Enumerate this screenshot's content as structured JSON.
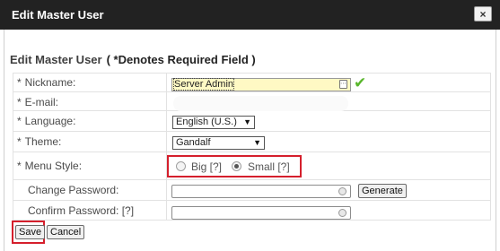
{
  "dialog": {
    "title": "Edit Master User",
    "close_glyph": "×"
  },
  "form": {
    "heading": "Edit Master User",
    "required_note": "( *Denotes Required Field )",
    "fields": {
      "nickname": {
        "star": "*",
        "label": "Nickname:",
        "value": "Server Admin"
      },
      "email": {
        "star": "*",
        "label": "E-mail:"
      },
      "language": {
        "star": "*",
        "label": "Language:",
        "value": "English (U.S.)"
      },
      "theme": {
        "star": "*",
        "label": "Theme:",
        "value": "Gandalf"
      },
      "menu_style": {
        "star": "*",
        "label": "Menu Style:",
        "options": [
          {
            "label": "Big [?]",
            "selected": false
          },
          {
            "label": "Small [?]",
            "selected": true
          }
        ]
      },
      "change_password": {
        "label": "Change Password:",
        "generate_label": "Generate"
      },
      "confirm_password": {
        "label": "Confirm Password: [?]"
      }
    }
  },
  "buttons": {
    "save": "Save",
    "cancel": "Cancel"
  },
  "colors": {
    "title_bar": "#222222",
    "highlight_box": "#d51f2c",
    "nickname_bg": "#fff9c4",
    "check": "#59b62c"
  }
}
